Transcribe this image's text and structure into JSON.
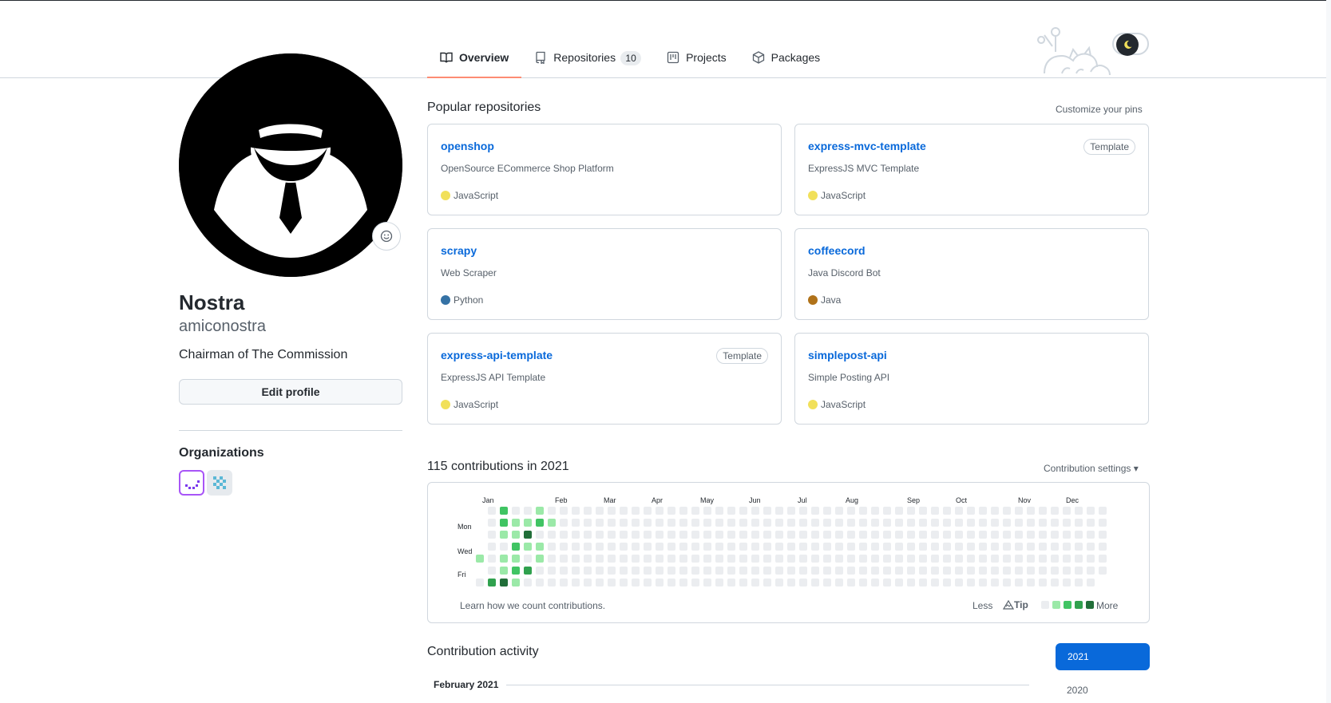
{
  "tabs": [
    {
      "label": "Overview",
      "icon": "book-icon",
      "active": true
    },
    {
      "label": "Repositories",
      "icon": "repo-icon",
      "count": "10"
    },
    {
      "label": "Projects",
      "icon": "project-icon"
    },
    {
      "label": "Packages",
      "icon": "package-icon"
    }
  ],
  "profile": {
    "name": "Nostra",
    "login": "amiconostra",
    "bio": "Chairman of The Commission",
    "edit_label": "Edit profile",
    "organizations_title": "Organizations"
  },
  "popular": {
    "title": "Popular repositories",
    "customize_label": "Customize your pins",
    "repos": [
      {
        "name": "openshop",
        "desc": "OpenSource ECommerce Shop Platform",
        "lang": "JavaScript",
        "lang_color": "#f1e05a",
        "badge": ""
      },
      {
        "name": "express-mvc-template",
        "desc": "ExpressJS MVC Template",
        "lang": "JavaScript",
        "lang_color": "#f1e05a",
        "badge": "Template"
      },
      {
        "name": "scrapy",
        "desc": "Web Scraper",
        "lang": "Python",
        "lang_color": "#3572A5",
        "badge": ""
      },
      {
        "name": "coffeecord",
        "desc": "Java Discord Bot",
        "lang": "Java",
        "lang_color": "#b07219",
        "badge": ""
      },
      {
        "name": "express-api-template",
        "desc": "ExpressJS API Template",
        "lang": "JavaScript",
        "lang_color": "#f1e05a",
        "badge": "Template"
      },
      {
        "name": "simplepost-api",
        "desc": "Simple Posting API",
        "lang": "JavaScript",
        "lang_color": "#f1e05a",
        "badge": ""
      }
    ]
  },
  "contributions": {
    "title": "115 contributions in 2021",
    "settings_label": "Contribution settings ▾",
    "months": [
      "Jan",
      "Feb",
      "Mar",
      "Apr",
      "May",
      "Jun",
      "Jul",
      "Aug",
      "Sep",
      "Oct",
      "Nov",
      "Dec"
    ],
    "days": [
      "Mon",
      "Wed",
      "Fri"
    ],
    "learn_label": "Learn how we count contributions.",
    "less_label": "Less",
    "tip_label": "Tip",
    "more_label": "More",
    "levels": [
      "#ebedf0",
      "#9be9a8",
      "#40c463",
      "#30a14e",
      "#216e39"
    ],
    "active_weeks": [
      [
        null,
        null,
        null,
        null,
        1,
        null,
        0
      ],
      [
        0,
        0,
        0,
        0,
        0,
        0,
        3
      ],
      [
        2,
        2,
        1,
        0,
        1,
        1,
        4
      ],
      [
        0,
        1,
        1,
        2,
        1,
        2,
        1
      ],
      [
        0,
        1,
        4,
        1,
        0,
        3,
        0
      ],
      [
        1,
        2,
        0,
        1,
        1,
        0,
        0
      ],
      [
        0,
        1,
        0,
        0,
        0,
        0,
        0
      ]
    ]
  },
  "activity": {
    "title": "Contribution activity",
    "month": "February 2021",
    "years": [
      "2021",
      "2020"
    ]
  }
}
